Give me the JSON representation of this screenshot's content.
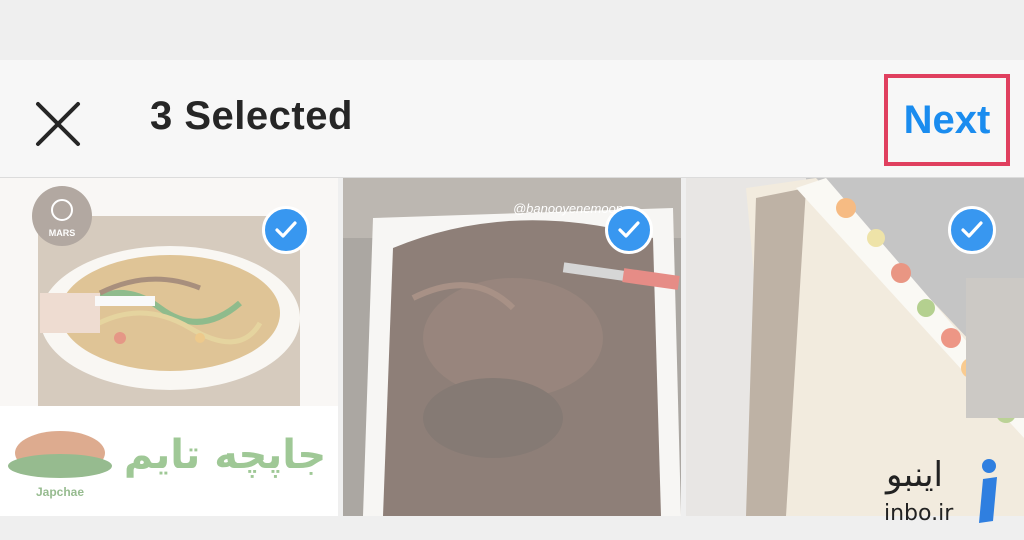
{
  "header": {
    "title": "3 Selected",
    "next_label": "Next"
  },
  "photos": [
    {
      "caption_text": "جاپچه تایم",
      "brand_small": "Japchae",
      "badge_text": "MARS",
      "selected": true
    },
    {
      "caption_text": "@banooyenemoon",
      "selected": true
    },
    {
      "selected": true
    }
  ],
  "watermark": {
    "persian": "اینبو",
    "latin": "inbo.ir"
  },
  "colors": {
    "accent": "#3897f0",
    "next_text": "#1a8cef",
    "highlight_border": "#e0405f"
  }
}
